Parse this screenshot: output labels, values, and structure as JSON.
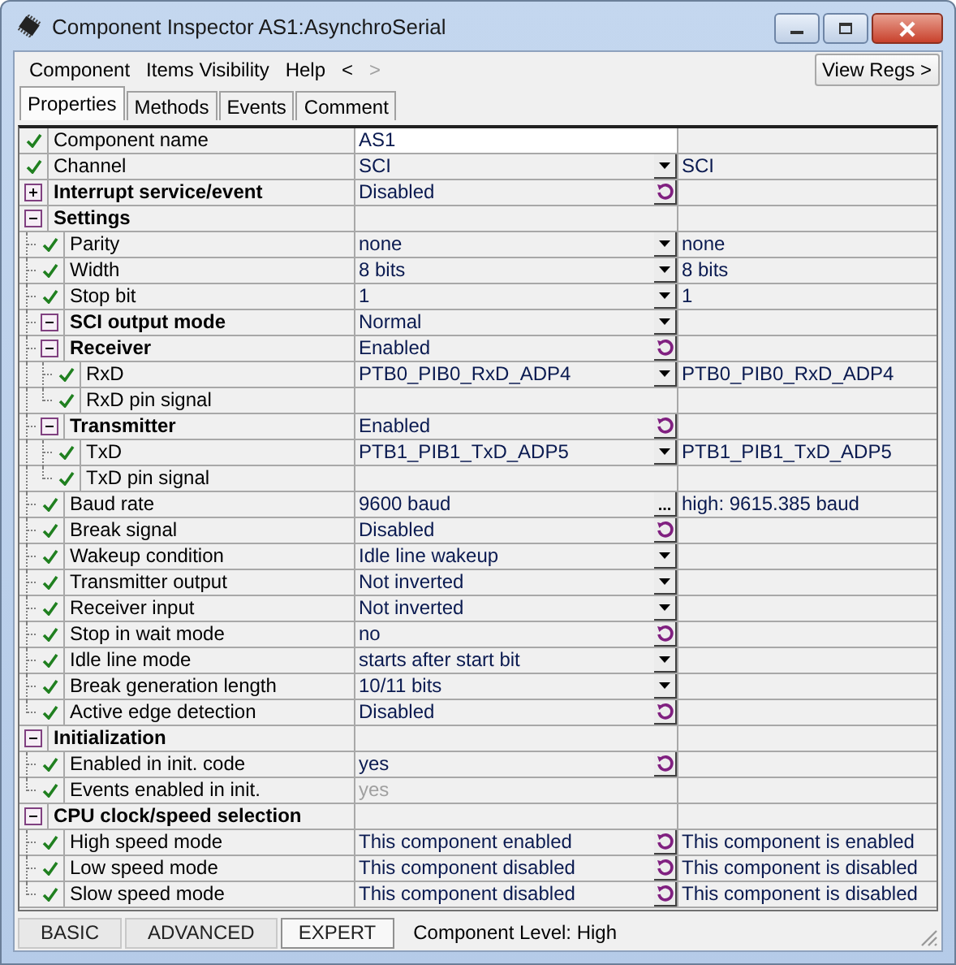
{
  "window": {
    "title": "Component Inspector AS1:AsynchroSerial"
  },
  "menu": [
    {
      "label": "Component",
      "disabled": false
    },
    {
      "label": "Items Visibility",
      "disabled": false
    },
    {
      "label": "Help",
      "disabled": false
    },
    {
      "label": "<",
      "disabled": false
    },
    {
      "label": ">",
      "disabled": true
    }
  ],
  "view_regs_button": "View Regs >",
  "tabs": [
    {
      "label": "Properties",
      "selected": true
    },
    {
      "label": "Methods",
      "selected": false
    },
    {
      "label": "Events",
      "selected": false
    },
    {
      "label": "Comment",
      "selected": false
    }
  ],
  "rows": [
    {
      "kind": "property",
      "name": "Component name",
      "value": "AS1",
      "control": {
        "kind": "edit"
      },
      "disabled": false
    },
    {
      "kind": "property",
      "name": "Channel",
      "value": "SCI",
      "control": {
        "kind": "dropdown"
      },
      "extra": "SCI",
      "disabled": false
    },
    {
      "kind": "group",
      "name": "Interrupt service/event",
      "value": "Disabled",
      "control": {
        "kind": "cycle"
      },
      "expanded": false,
      "disabled": false
    },
    {
      "kind": "group",
      "name": "Settings",
      "expanded": true,
      "children": [
        {
          "kind": "property",
          "name": "Parity",
          "value": "none",
          "control": {
            "kind": "dropdown"
          },
          "extra": "none",
          "disabled": false
        },
        {
          "kind": "property",
          "name": "Width",
          "value": "8 bits",
          "control": {
            "kind": "dropdown"
          },
          "extra": "8 bits",
          "disabled": false
        },
        {
          "kind": "property",
          "name": "Stop bit",
          "value": "1",
          "control": {
            "kind": "dropdown"
          },
          "extra": "1",
          "disabled": false
        },
        {
          "kind": "group",
          "name": "SCI output mode",
          "value": "Normal",
          "control": {
            "kind": "dropdown"
          },
          "expanded": true,
          "disabled": false
        },
        {
          "kind": "group",
          "name": "Receiver",
          "value": "Enabled",
          "control": {
            "kind": "cycle"
          },
          "expanded": true,
          "disabled": false,
          "children": [
            {
              "kind": "property",
              "name": "RxD",
              "value": "PTB0_PIB0_RxD_ADP4",
              "control": {
                "kind": "dropdown"
              },
              "extra": "PTB0_PIB0_RxD_ADP4",
              "disabled": false
            },
            {
              "kind": "property",
              "name": "RxD pin signal"
            }
          ]
        },
        {
          "kind": "group",
          "name": "Transmitter",
          "value": "Enabled",
          "control": {
            "kind": "cycle"
          },
          "expanded": true,
          "disabled": false,
          "children": [
            {
              "kind": "property",
              "name": "TxD",
              "value": "PTB1_PIB1_TxD_ADP5",
              "control": {
                "kind": "dropdown"
              },
              "extra": "PTB1_PIB1_TxD_ADP5",
              "disabled": false
            },
            {
              "kind": "property",
              "name": "TxD pin signal"
            }
          ]
        },
        {
          "kind": "property",
          "name": "Baud rate",
          "value": "9600 baud",
          "control": {
            "kind": "dots",
            "label": "..."
          },
          "extra": "high: 9615.385 baud",
          "disabled": false
        },
        {
          "kind": "property",
          "name": "Break signal",
          "value": "Disabled",
          "control": {
            "kind": "cycle"
          },
          "disabled": false
        },
        {
          "kind": "property",
          "name": "Wakeup condition",
          "value": "Idle line wakeup",
          "control": {
            "kind": "dropdown"
          },
          "disabled": false
        },
        {
          "kind": "property",
          "name": "Transmitter output",
          "value": "Not inverted",
          "control": {
            "kind": "dropdown"
          },
          "disabled": false
        },
        {
          "kind": "property",
          "name": "Receiver input",
          "value": "Not inverted",
          "control": {
            "kind": "dropdown"
          },
          "disabled": false
        },
        {
          "kind": "property",
          "name": "Stop in wait mode",
          "value": "no",
          "control": {
            "kind": "cycle"
          },
          "disabled": false
        },
        {
          "kind": "property",
          "name": "Idle line mode",
          "value": "starts after start bit",
          "control": {
            "kind": "dropdown"
          },
          "disabled": false
        },
        {
          "kind": "property",
          "name": "Break generation length",
          "value": "10/11 bits",
          "control": {
            "kind": "dropdown"
          },
          "disabled": false
        },
        {
          "kind": "property",
          "name": "Active edge detection",
          "value": "Disabled",
          "control": {
            "kind": "cycle"
          },
          "disabled": false
        }
      ]
    },
    {
      "kind": "group",
      "name": "Initialization",
      "expanded": true,
      "children": [
        {
          "kind": "property",
          "name": "Enabled in init. code",
          "value": "yes",
          "control": {
            "kind": "cycle"
          },
          "disabled": false
        },
        {
          "kind": "property",
          "name": "Events enabled in init.",
          "value": "yes",
          "disabled": true
        }
      ]
    },
    {
      "kind": "group",
      "name": "CPU clock/speed selection",
      "expanded": true,
      "children": [
        {
          "kind": "property",
          "name": "High speed mode",
          "value": "This component enabled",
          "control": {
            "kind": "cycle"
          },
          "extra": "This component is enabled",
          "disabled": false
        },
        {
          "kind": "property",
          "name": "Low speed mode",
          "value": "This component disabled",
          "control": {
            "kind": "cycle"
          },
          "extra": "This component is disabled",
          "disabled": false
        },
        {
          "kind": "property",
          "name": "Slow speed mode",
          "value": "This component disabled",
          "control": {
            "kind": "cycle"
          },
          "extra": "This component is disabled",
          "disabled": false
        }
      ]
    }
  ],
  "level_buttons": [
    {
      "label": "BASIC",
      "selected": false
    },
    {
      "label": "ADVANCED",
      "selected": false
    },
    {
      "label": "EXPERT",
      "selected": true
    }
  ],
  "status": "Component Level: High"
}
